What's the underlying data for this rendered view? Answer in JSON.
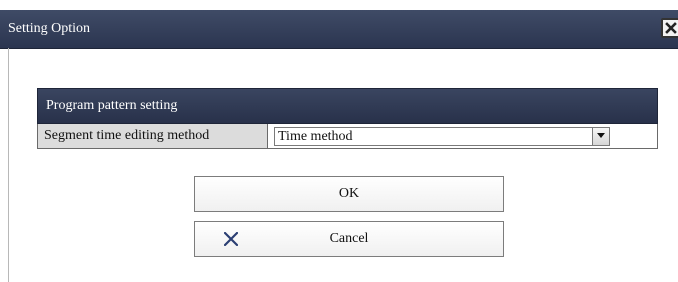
{
  "dialog": {
    "title": "Setting Option",
    "close_icon": "close-icon"
  },
  "panel": {
    "header": "Program pattern setting",
    "rows": [
      {
        "label": "Segment time editing method",
        "value": "Time method",
        "control": "dropdown"
      }
    ]
  },
  "buttons": {
    "ok_label": "OK",
    "cancel_label": "Cancel",
    "cancel_icon": "x-icon"
  },
  "colors": {
    "titlebar": "#2f3a55",
    "cancel_icon": "#2b3f73"
  }
}
